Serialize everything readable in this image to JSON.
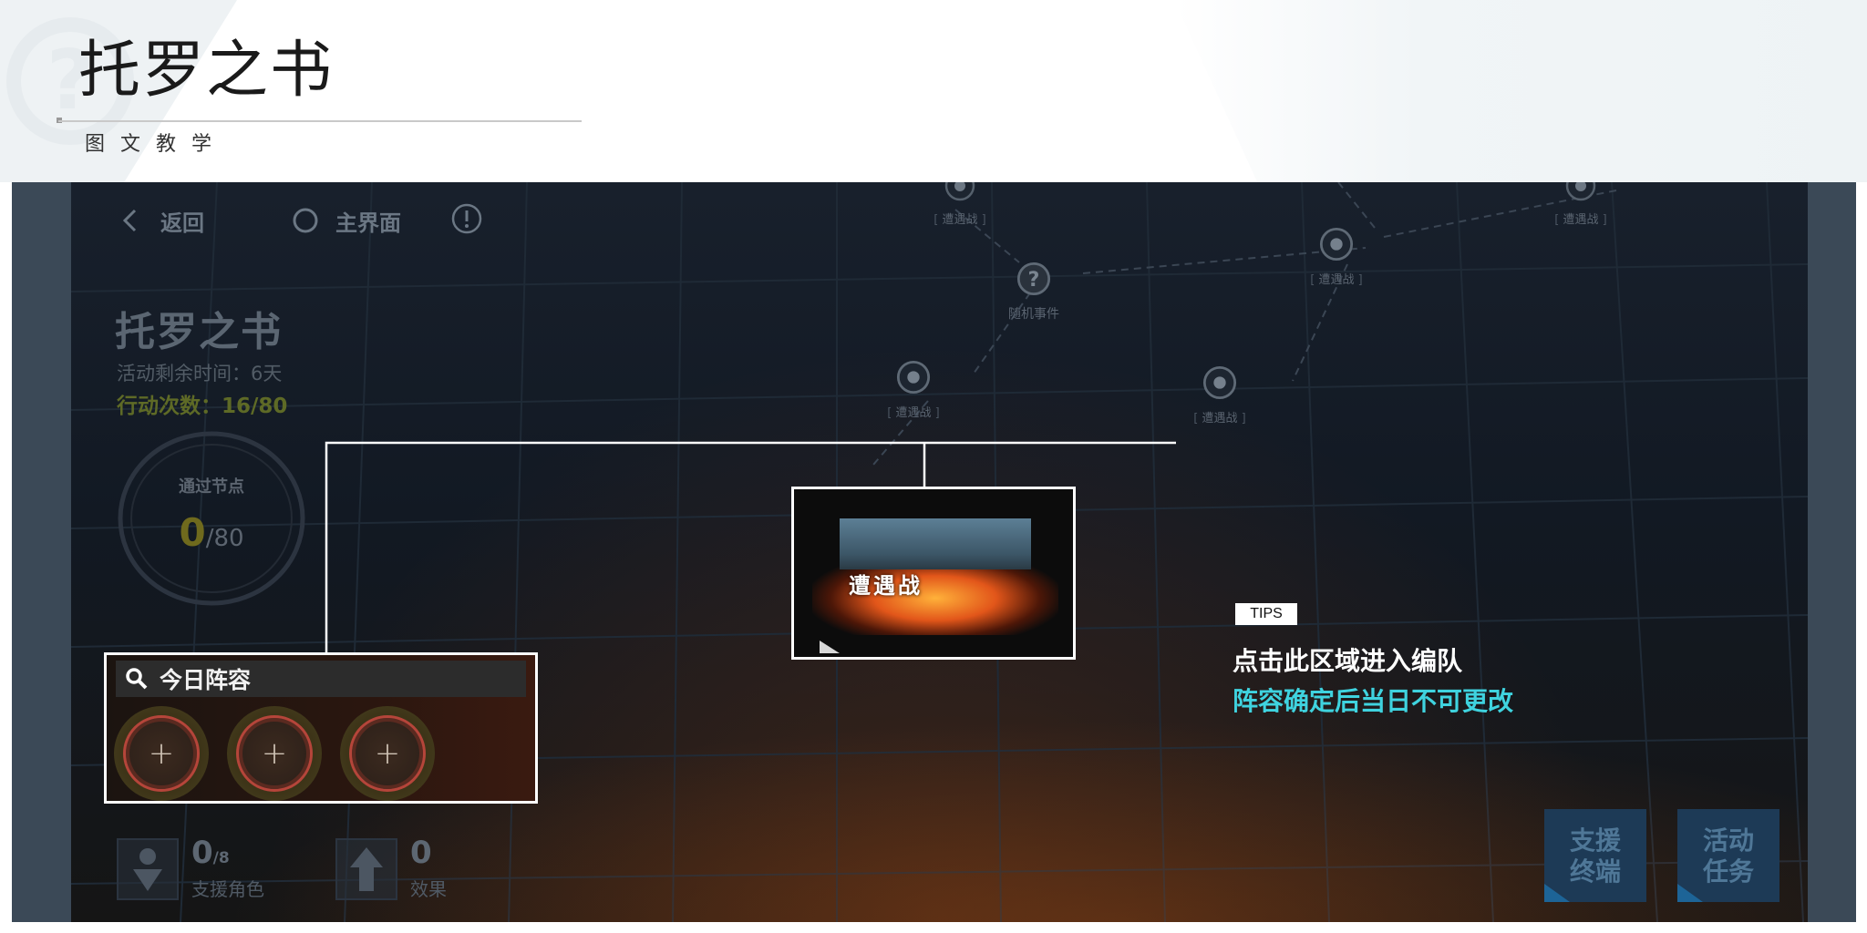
{
  "slide": {
    "title": "托罗之书",
    "subtitle": "图文教学"
  },
  "nav": {
    "back_label": "返回",
    "home_label": "主界面"
  },
  "event": {
    "title": "托罗之书",
    "time_remaining": "活动剩余时间：6天",
    "action_count": "行动次数：16/80",
    "nodes_label": "通过节点",
    "nodes_current": "0",
    "nodes_total": "/80"
  },
  "map_nodes": [
    {
      "label": "遭遇战",
      "icon": "target-icon"
    },
    {
      "label": "遭遇战",
      "icon": "target-icon"
    },
    {
      "label": "遭遇战",
      "icon": "target-icon"
    },
    {
      "label": "遭遇战",
      "icon": "target-icon"
    },
    {
      "label": "遭遇战",
      "icon": "target-icon"
    },
    {
      "label": "随机事件",
      "icon": "question-icon"
    }
  ],
  "encounter": {
    "label": "遭遇战"
  },
  "lineup": {
    "title": "今日阵容",
    "slot_symbol": "+"
  },
  "tips": {
    "tag": "TIPS",
    "main": "点击此区域进入编队",
    "note": "阵容确定后当日不可更改"
  },
  "stats": {
    "support_value": "0",
    "support_total": "/8",
    "support_label": "支援角色",
    "effect_value": "0",
    "effect_label": "效果"
  },
  "buttons": {
    "support_terminal": "支援终端",
    "event_tasks": "活动任务"
  },
  "colors": {
    "tip_accent": "#3fd3df",
    "action_count": "#5e6a26",
    "progress_value": "#6f6a1d"
  }
}
